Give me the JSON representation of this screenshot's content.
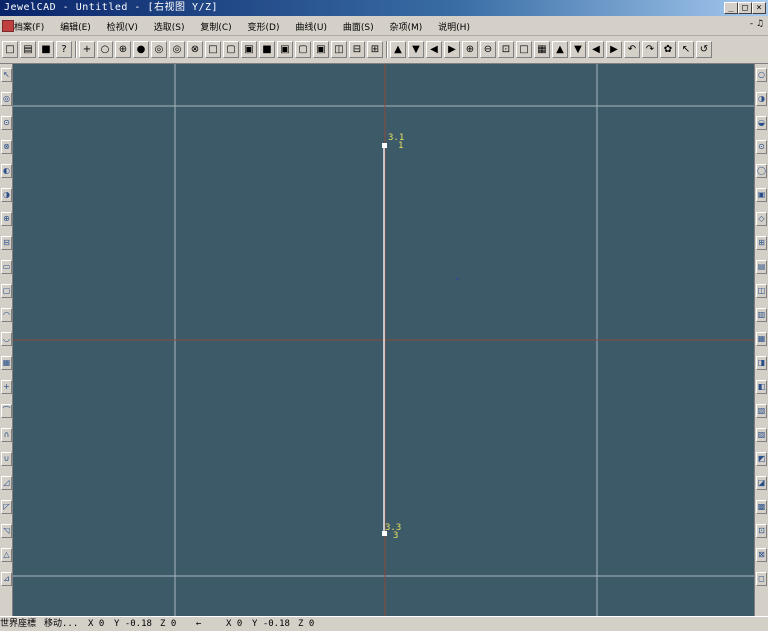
{
  "window": {
    "title": "JewelCAD - Untitled - [右视图 Y/Z]",
    "controls": [
      "_",
      "□",
      "×"
    ]
  },
  "menu": {
    "items": [
      "档案(F)",
      "编辑(E)",
      "检视(V)",
      "选取(S)",
      "复制(C)",
      "变形(D)",
      "曲线(U)",
      "曲面(S)",
      "杂项(M)",
      "说明(H)"
    ],
    "mdi_controls": "- ♫"
  },
  "toolbar": {
    "icons": [
      "new-icon",
      "open-icon",
      "save-icon",
      "help-icon",
      "point-icon",
      "circle-icon",
      "sphere-icon",
      "sphere-filled-icon",
      "ring-icon",
      "ring2-icon",
      "ring3-icon",
      "box-icon",
      "view-icon",
      "view2-icon",
      "view3-icon",
      "view4-icon",
      "view5-icon",
      "view6-icon",
      "split-icon",
      "grid-icon",
      "grid2-icon",
      "up-icon",
      "down-icon",
      "left-icon",
      "right-icon",
      "zoom-in-icon",
      "zoom-out-icon",
      "zoom-fit-icon",
      "zoom-box-icon",
      "zoom-all-icon",
      "arrow-up-icon",
      "arrow-down-icon",
      "arrow-left-icon",
      "arrow-right-icon",
      "rotate-icon",
      "rotate2-icon",
      "render-icon",
      "select-icon",
      "undo-icon"
    ],
    "glyphs": [
      "□",
      "▤",
      "■",
      "?",
      "+",
      "○",
      "⊕",
      "●",
      "◎",
      "◎",
      "⊗",
      "□",
      "▢",
      "▣",
      "■",
      "▣",
      "▢",
      "▣",
      "◫",
      "⊟",
      "⊞",
      "▲",
      "▼",
      "◀",
      "▶",
      "⊕",
      "⊖",
      "⊡",
      "□",
      "▦",
      "▲",
      "▼",
      "◀",
      "▶",
      "↶",
      "↷",
      "✿",
      "↖",
      "↺"
    ]
  },
  "viewport": {
    "background": "#3d5a68",
    "point_labels": {
      "top": "3.1",
      "top_sub": "1",
      "bottom": "3.3",
      "bottom_sub": "3"
    }
  },
  "status": {
    "coord_system": "世界座標",
    "mode": "移动...",
    "x1": "X 0",
    "y1": "Y -0.18",
    "z1": "Z 0",
    "arrow": "←",
    "x2": "X 0",
    "y2": "Y -0.18",
    "z2": "Z 0"
  }
}
